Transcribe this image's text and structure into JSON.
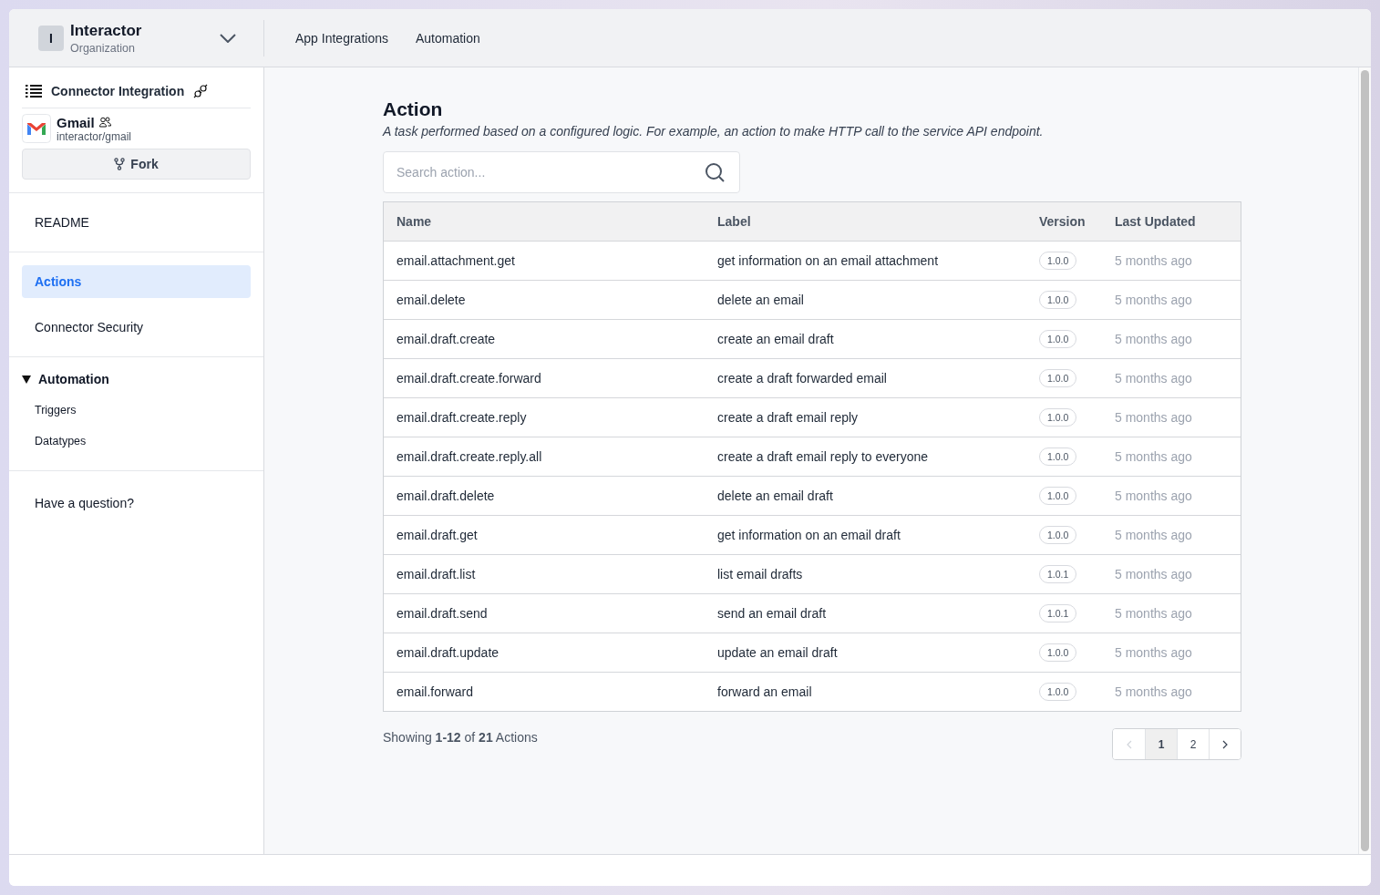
{
  "header": {
    "org_initial": "I",
    "org_name": "Interactor",
    "org_type": "Organization",
    "nav": [
      {
        "label": "App Integrations"
      },
      {
        "label": "Automation"
      }
    ]
  },
  "sidebar": {
    "section_title": "Connector Integration",
    "connector": {
      "name": "Gmail",
      "path": "interactor/gmail"
    },
    "fork_button": "Fork",
    "items": [
      {
        "label": "README",
        "selected": false
      },
      {
        "label": "Actions",
        "selected": true
      },
      {
        "label": "Connector Security",
        "selected": false
      }
    ],
    "automation": {
      "label": "Automation",
      "expanded": true,
      "children": [
        {
          "label": "Triggers"
        },
        {
          "label": "Datatypes"
        }
      ]
    },
    "help": "Have a question?"
  },
  "main": {
    "title": "Action",
    "description": "A task performed based on a configured logic. For example, an action to make HTTP call to the service API endpoint.",
    "search": {
      "placeholder": "Search action..."
    },
    "table": {
      "columns": [
        "Name",
        "Label",
        "Version",
        "Last Updated"
      ],
      "rows": [
        {
          "name": "email.attachment.get",
          "label": "get information on an email attachment",
          "version": "1.0.0",
          "updated": "5 months ago"
        },
        {
          "name": "email.delete",
          "label": "delete an email",
          "version": "1.0.0",
          "updated": "5 months ago"
        },
        {
          "name": "email.draft.create",
          "label": "create an email draft",
          "version": "1.0.0",
          "updated": "5 months ago"
        },
        {
          "name": "email.draft.create.forward",
          "label": "create a draft forwarded email",
          "version": "1.0.0",
          "updated": "5 months ago"
        },
        {
          "name": "email.draft.create.reply",
          "label": "create a draft email reply",
          "version": "1.0.0",
          "updated": "5 months ago"
        },
        {
          "name": "email.draft.create.reply.all",
          "label": "create a draft email reply to everyone",
          "version": "1.0.0",
          "updated": "5 months ago"
        },
        {
          "name": "email.draft.delete",
          "label": "delete an email draft",
          "version": "1.0.0",
          "updated": "5 months ago"
        },
        {
          "name": "email.draft.get",
          "label": "get information on an email draft",
          "version": "1.0.0",
          "updated": "5 months ago"
        },
        {
          "name": "email.draft.list",
          "label": "list email drafts",
          "version": "1.0.1",
          "updated": "5 months ago"
        },
        {
          "name": "email.draft.send",
          "label": "send an email draft",
          "version": "1.0.1",
          "updated": "5 months ago"
        },
        {
          "name": "email.draft.update",
          "label": "update an email draft",
          "version": "1.0.0",
          "updated": "5 months ago"
        },
        {
          "name": "email.forward",
          "label": "forward an email",
          "version": "1.0.0",
          "updated": "5 months ago"
        }
      ]
    },
    "summary": "Showing **1-12** of **21** Actions",
    "pagination": {
      "prev_disabled": true,
      "pages": [
        {
          "label": "1",
          "selected": true
        },
        {
          "label": "2",
          "selected": false
        }
      ]
    }
  }
}
